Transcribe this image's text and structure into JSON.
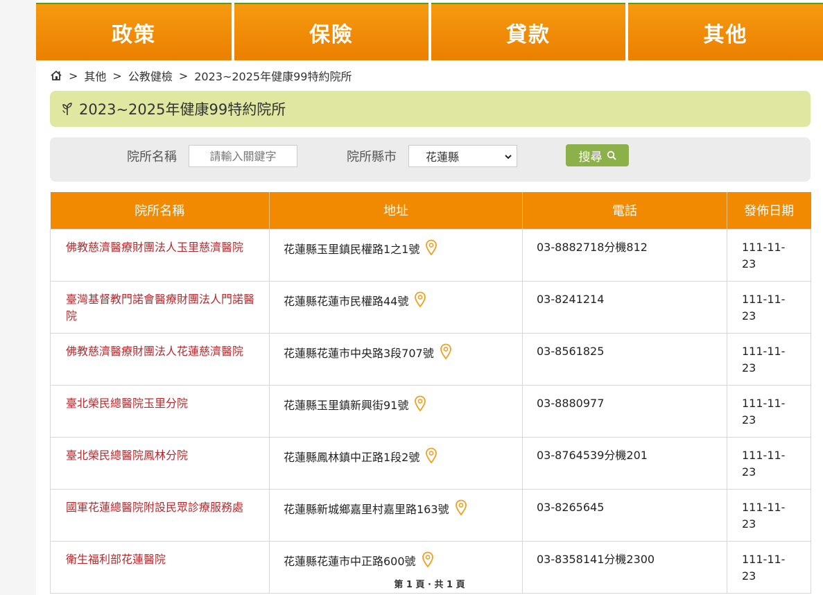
{
  "nav": {
    "items": [
      "政策",
      "保險",
      "貸款",
      "其他"
    ]
  },
  "breadcrumb": {
    "items": [
      "其他",
      "公教健檢",
      "2023~2025年健康99特約院所"
    ],
    "separator": ">"
  },
  "page_title": "2023~2025年健康99特約院所",
  "search": {
    "name_label": "院所名稱",
    "name_placeholder": "請輸入關鍵字",
    "city_label": "院所縣市",
    "city_value": "花蓮縣",
    "button_label": "搜尋"
  },
  "table": {
    "headers": [
      "院所名稱",
      "地址",
      "電話",
      "發佈日期"
    ],
    "rows": [
      {
        "name": "佛教慈濟醫療財團法人玉里慈濟醫院",
        "address": "花蓮縣玉里鎮民權路1之1號",
        "phone": "03-8882718分機812",
        "date": "111-11-23"
      },
      {
        "name": "臺灣基督教門諾會醫療財團法人門諾醫院",
        "address": "花蓮縣花蓮市民權路44號",
        "phone": "03-8241214",
        "date": "111-11-23"
      },
      {
        "name": "佛教慈濟醫療財團法人花蓮慈濟醫院",
        "address": "花蓮縣花蓮市中央路3段707號",
        "phone": "03-8561825",
        "date": "111-11-23"
      },
      {
        "name": "臺北榮民總醫院玉里分院",
        "address": "花蓮縣玉里鎮新興街91號",
        "phone": "03-8880977",
        "date": "111-11-23"
      },
      {
        "name": "臺北榮民總醫院鳳林分院",
        "address": "花蓮縣鳳林鎮中正路1段2號",
        "phone": "03-8764539分機201",
        "date": "111-11-23"
      },
      {
        "name": "國軍花蓮總醫院附設民眾診療服務處",
        "address": "花蓮縣新城鄉嘉里村嘉里路163號",
        "phone": "03-8265645",
        "date": "111-11-23"
      },
      {
        "name": "衛生福利部花蓮醫院",
        "address": "花蓮縣花蓮市中正路600號",
        "phone": "03-8358141分機2300",
        "date": "111-11-23"
      }
    ]
  },
  "pager": "第 1 頁 · 共 1 頁",
  "colors": {
    "nav_orange": "#ec7f00",
    "header_orange": "#f18a00",
    "title_bg": "#dfe7a0",
    "search_btn": "#8cb04a",
    "link_red": "#b5292d"
  }
}
